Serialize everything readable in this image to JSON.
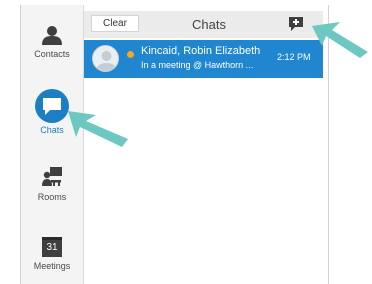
{
  "nav": {
    "items": [
      {
        "label": "Contacts",
        "icon": "person-icon",
        "active": false
      },
      {
        "label": "Chats",
        "icon": "chat-bubble-icon",
        "active": true
      },
      {
        "label": "Rooms",
        "icon": "rooms-icon",
        "active": false
      },
      {
        "label": "Meetings",
        "icon": "calendar-icon",
        "active": false,
        "calendar_day": "31"
      }
    ]
  },
  "header": {
    "clear_label": "Clear",
    "title": "Chats",
    "new_chat_icon": "new-chat-icon"
  },
  "chats": [
    {
      "name": "Kincaid, Robin Elizabeth",
      "status": "In a meeting @ Hawthorn ...",
      "time": "2:12 PM",
      "presence_color": "#f5a623"
    }
  ],
  "colors": {
    "accent": "#1f86cf",
    "highlight_arrow": "#6cc8c0",
    "presence_busy": "#f5a623"
  }
}
